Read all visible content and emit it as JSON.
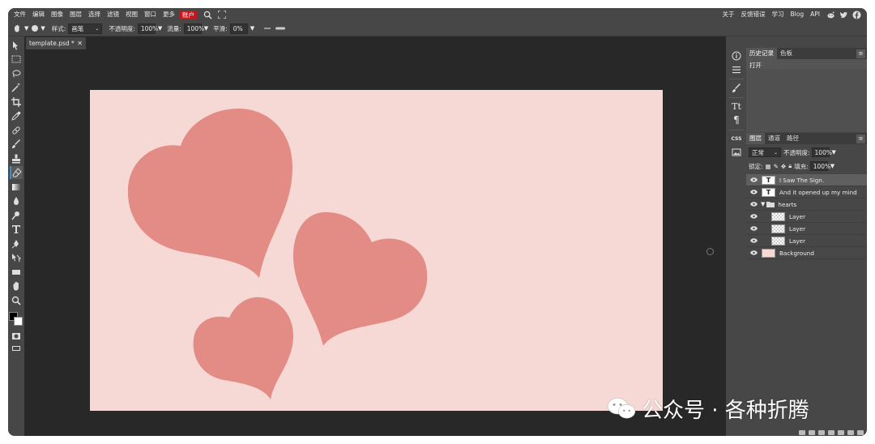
{
  "menubar": {
    "items": [
      "文件",
      "编辑",
      "图像",
      "图层",
      "选择",
      "滤镜",
      "视图",
      "窗口",
      "更多"
    ],
    "account": "账户",
    "right_items": [
      "关于",
      "反馈错误",
      "学习",
      "Blog",
      "API"
    ],
    "account_color": "#c8161d"
  },
  "options": {
    "style_label": "样式:",
    "style_value": "画笔",
    "opacity_label": "不透明度:",
    "opacity_value": "100%",
    "flow_label": "流量:",
    "flow_value": "100%",
    "smooth_label": "平滑:",
    "smooth_value": "0%"
  },
  "document": {
    "tab_title": "template.psd *",
    "canvas_color": "#f6d9d5",
    "heart_color": "#e38c86"
  },
  "history": {
    "tabs": [
      "历史记录",
      "色板"
    ],
    "items": [
      "打开"
    ]
  },
  "layers_panel": {
    "tabs": [
      "图层",
      "通道",
      "路径"
    ],
    "blend_mode": "正常",
    "opacity_label": "不透明度:",
    "opacity_value": "100%",
    "lock_label": "锁定:",
    "fill_label": "填充:",
    "fill_value": "100%",
    "layers": [
      {
        "name": "I Saw The Sign.",
        "kind": "text"
      },
      {
        "name": "And it opened up my mind",
        "kind": "text"
      },
      {
        "name": "hearts",
        "kind": "folder"
      },
      {
        "name": "Layer",
        "kind": "raster"
      },
      {
        "name": "Layer",
        "kind": "raster"
      },
      {
        "name": "Layer",
        "kind": "raster"
      },
      {
        "name": "Background",
        "kind": "background"
      }
    ]
  },
  "iconcol": {
    "css_label": "CSS"
  },
  "watermark": {
    "text": "公众号 · 各种折腾"
  }
}
